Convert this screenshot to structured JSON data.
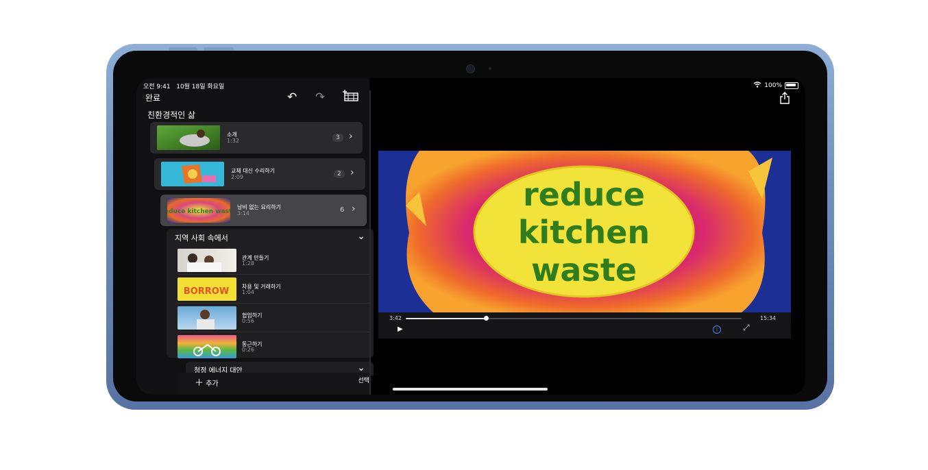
{
  "status": {
    "time_date": "오전 9:41   10월 18일 화요일",
    "battery": "100%"
  },
  "toolbar": {
    "done_label": "완료",
    "undo_icon": "undo-icon",
    "redo_icon": "redo-icon",
    "media_icon": "film-add-icon"
  },
  "project": {
    "title": "친환경적인 삶"
  },
  "chapters": [
    {
      "title": "소개",
      "duration": "1:32",
      "count": "3"
    },
    {
      "title": "교체 대신 수리하기",
      "duration": "2:09",
      "count": "2"
    },
    {
      "title": "낭비 없는 요리하기",
      "duration": "3:14",
      "count": "6"
    }
  ],
  "group": {
    "title": "지역 사회 속에서",
    "items": [
      {
        "title": "관계 만들기",
        "duration": "1:28"
      },
      {
        "title": "차용 및 거래하기",
        "duration": "1:04"
      },
      {
        "title": "협업하기",
        "duration": "0:56"
      },
      {
        "title": "통근하기",
        "duration": "0:26"
      }
    ]
  },
  "group2": {
    "title": "청정 에너지 대안"
  },
  "bottom": {
    "add_label": "추가",
    "select_label": "선택"
  },
  "player": {
    "elapsed": "3:42",
    "total": "15:34",
    "progress": 0.238
  },
  "video": {
    "line1": "reduce",
    "line2": "kitchen",
    "line3": "waste"
  },
  "thumb_texts": {
    "borrow": "BORROW",
    "waste": "reduce kitchen waste"
  },
  "colors": {
    "frame": "#7f9ecb",
    "accent": "#3b82f6",
    "text_green": "#2f7d1f",
    "text_yellow": "#f0e33a"
  }
}
